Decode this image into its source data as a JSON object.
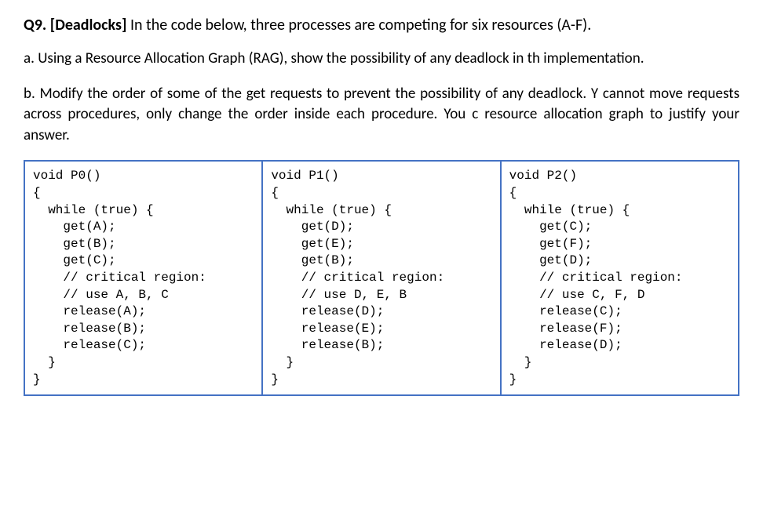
{
  "question": {
    "number": "Q9.",
    "topic": "[Deadlocks]",
    "intro": "In the code below, three processes are competing for six resources (A-F)."
  },
  "parts": {
    "a": "a. Using a Resource Allocation Graph (RAG), show the possibility of any deadlock in th implementation.",
    "b": "b. Modify the order of some of the get requests to prevent the possibility of any deadlock. Y cannot move requests across procedures, only change the order inside each procedure. You c resource allocation graph to justify your answer."
  },
  "code": {
    "p0": "void P0()\n{\n  while (true) {\n    get(A);\n    get(B);\n    get(C);\n    // critical region:\n    // use A, B, C\n    release(A);\n    release(B);\n    release(C);\n  }\n}",
    "p1": "void P1()\n{\n  while (true) {\n    get(D);\n    get(E);\n    get(B);\n    // critical region:\n    // use D, E, B\n    release(D);\n    release(E);\n    release(B);\n  }\n}",
    "p2": "void P2()\n{\n  while (true) {\n    get(C);\n    get(F);\n    get(D);\n    // critical region:\n    // use C, F, D\n    release(C);\n    release(F);\n    release(D);\n  }\n}"
  }
}
